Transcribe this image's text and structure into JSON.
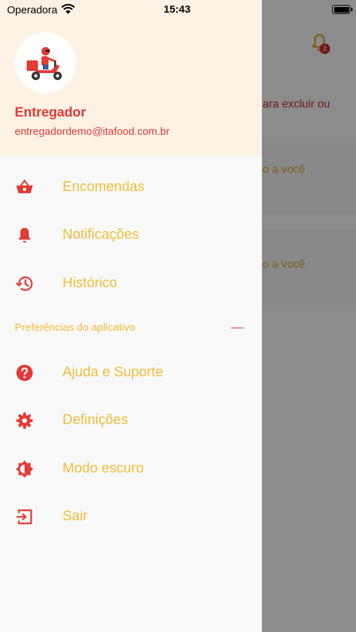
{
  "status_bar": {
    "carrier": "Operadora",
    "time": "15:43"
  },
  "background": {
    "line1": "ara excluir ou",
    "line2": "o a você",
    "line3": "o a você",
    "badge": "2"
  },
  "drawer": {
    "user": {
      "name": "Entregador",
      "email": "entregadordemo@itafood.com.br"
    },
    "menu_top": [
      {
        "label": "Encomendas",
        "icon": "basket-icon"
      },
      {
        "label": "Notificações",
        "icon": "bell-icon"
      },
      {
        "label": "Histórico",
        "icon": "history-icon"
      }
    ],
    "section_title": "Preferências do aplicativo",
    "menu_bottom": [
      {
        "label": "Ajuda e Suporte",
        "icon": "help-icon"
      },
      {
        "label": "Definições",
        "icon": "gear-icon"
      },
      {
        "label": "Modo escuro",
        "icon": "brightness-icon"
      },
      {
        "label": "Sair",
        "icon": "logout-icon"
      }
    ]
  },
  "colors": {
    "accent_red": "#e53935",
    "label_yellow": "#f1bc3a",
    "header_bg": "#fdf2e4"
  }
}
